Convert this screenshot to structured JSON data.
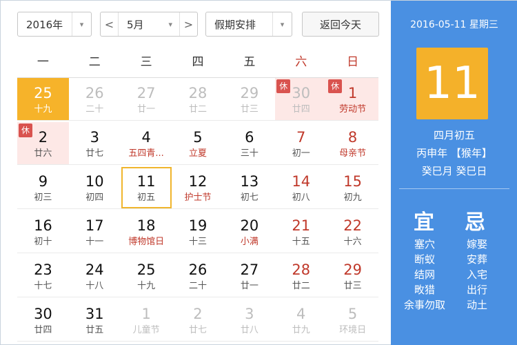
{
  "toolbar": {
    "year": "2016年",
    "month": "5月",
    "holiday": "假期安排",
    "return_label": "返回今天",
    "prev": "<",
    "next": ">",
    "caret": "▾"
  },
  "weekdays": [
    "一",
    "二",
    "三",
    "四",
    "五",
    "六",
    "日"
  ],
  "days": [
    {
      "num": "25",
      "lunar": "十九",
      "state": "today"
    },
    {
      "num": "26",
      "lunar": "二十",
      "state": "dim"
    },
    {
      "num": "27",
      "lunar": "廿一",
      "state": "dim"
    },
    {
      "num": "28",
      "lunar": "廿二",
      "state": "dim"
    },
    {
      "num": "29",
      "lunar": "廿三",
      "state": "dim"
    },
    {
      "num": "30",
      "lunar": "廿四",
      "state": "dim",
      "rest": true,
      "badge": "休"
    },
    {
      "num": "1",
      "lunar": "劳动节",
      "state": "",
      "rest": true,
      "badge": "休",
      "weekend": true,
      "festival": true
    },
    {
      "num": "2",
      "lunar": "廿六",
      "state": "",
      "rest": true,
      "badge": "休"
    },
    {
      "num": "3",
      "lunar": "廿七",
      "state": ""
    },
    {
      "num": "4",
      "lunar": "五四青...",
      "state": "",
      "festival": true
    },
    {
      "num": "5",
      "lunar": "立夏",
      "state": "",
      "festival": true
    },
    {
      "num": "6",
      "lunar": "三十",
      "state": ""
    },
    {
      "num": "7",
      "lunar": "初一",
      "state": "",
      "weekend": true
    },
    {
      "num": "8",
      "lunar": "母亲节",
      "state": "",
      "weekend": true,
      "festival": true
    },
    {
      "num": "9",
      "lunar": "初三",
      "state": ""
    },
    {
      "num": "10",
      "lunar": "初四",
      "state": ""
    },
    {
      "num": "11",
      "lunar": "初五",
      "state": "selected"
    },
    {
      "num": "12",
      "lunar": "护士节",
      "state": "",
      "festival": true
    },
    {
      "num": "13",
      "lunar": "初七",
      "state": ""
    },
    {
      "num": "14",
      "lunar": "初八",
      "state": "",
      "weekend": true
    },
    {
      "num": "15",
      "lunar": "初九",
      "state": "",
      "weekend": true
    },
    {
      "num": "16",
      "lunar": "初十",
      "state": ""
    },
    {
      "num": "17",
      "lunar": "十一",
      "state": ""
    },
    {
      "num": "18",
      "lunar": "博物馆日",
      "state": "",
      "festival": true
    },
    {
      "num": "19",
      "lunar": "十三",
      "state": ""
    },
    {
      "num": "20",
      "lunar": "小满",
      "state": "",
      "festival": true
    },
    {
      "num": "21",
      "lunar": "十五",
      "state": "",
      "weekend": true
    },
    {
      "num": "22",
      "lunar": "十六",
      "state": "",
      "weekend": true
    },
    {
      "num": "23",
      "lunar": "十七",
      "state": ""
    },
    {
      "num": "24",
      "lunar": "十八",
      "state": ""
    },
    {
      "num": "25",
      "lunar": "十九",
      "state": ""
    },
    {
      "num": "26",
      "lunar": "二十",
      "state": ""
    },
    {
      "num": "27",
      "lunar": "廿一",
      "state": ""
    },
    {
      "num": "28",
      "lunar": "廿二",
      "state": "",
      "weekend": true
    },
    {
      "num": "29",
      "lunar": "廿三",
      "state": "",
      "weekend": true
    },
    {
      "num": "30",
      "lunar": "廿四",
      "state": ""
    },
    {
      "num": "31",
      "lunar": "廿五",
      "state": ""
    },
    {
      "num": "1",
      "lunar": "儿童节",
      "state": "dim"
    },
    {
      "num": "2",
      "lunar": "廿七",
      "state": "dim"
    },
    {
      "num": "3",
      "lunar": "廿八",
      "state": "dim"
    },
    {
      "num": "4",
      "lunar": "廿九",
      "state": "dim"
    },
    {
      "num": "5",
      "lunar": "环境日",
      "state": "dim"
    }
  ],
  "panel": {
    "date_line": "2016-05-11 星期三",
    "big_day": "11",
    "lunar_date": "四月初五",
    "ganzhi_year": "丙申年 【猴年】",
    "ganzhi_month_day": "癸巳月 癸巳日",
    "yi_title": "宜",
    "ji_title": "忌",
    "yi_items": [
      "塞穴",
      "断蚁",
      "结网",
      "畋猎",
      "余事勿取"
    ],
    "ji_items": [
      "嫁娶",
      "安葬",
      "入宅",
      "出行",
      "动土"
    ]
  },
  "colors": {
    "panel_bg": "#4a90e2",
    "today_bg": "#f6b32a",
    "holiday_red": "#c0392b",
    "rest_bg": "#fde8e6"
  }
}
